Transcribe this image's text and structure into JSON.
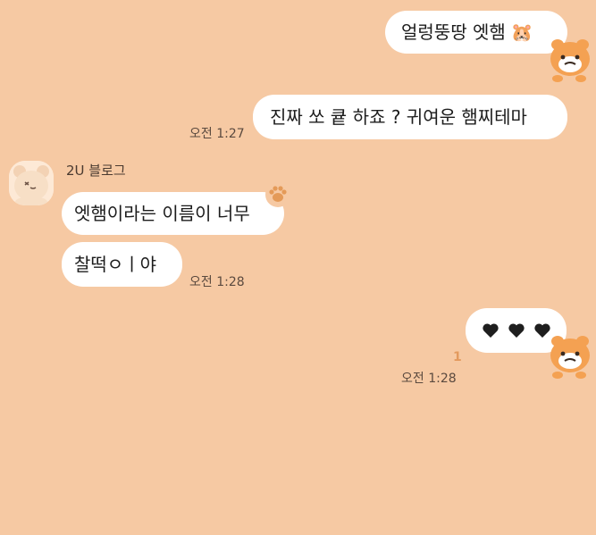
{
  "messages": {
    "sent_1": {
      "text": "얼렁뚱땅 엣햄"
    },
    "sent_1_emoji": "🐹",
    "sent_2": {
      "text": "진짜 쏘 큩 하죠 ? 귀여운 햄찌테마",
      "time": "오전 1:27"
    },
    "received_sender": "2U 블로그",
    "received_1": {
      "text": "엣햄이라는 이름이 너무"
    },
    "received_2": {
      "text": "찰떡ㅇㅣ야",
      "time": "오전 1:28"
    },
    "sent_3": {
      "time": "오전 1:28",
      "unread": "1"
    }
  },
  "icons": {
    "hamster_emoji": "hamster-face-icon",
    "hearts": [
      "black-heart-icon",
      "black-heart-icon",
      "black-heart-icon"
    ],
    "paw": "paw-icon",
    "sticker": "hamster-mascot-sticker",
    "avatar": "bear-avatar"
  },
  "colors": {
    "background": "#f6c9a3",
    "bubble": "#ffffff",
    "time_text": "#5b4a3f",
    "unread": "#e39a5e",
    "heart": "#1e1e1e",
    "mascot": "#f4a152"
  }
}
